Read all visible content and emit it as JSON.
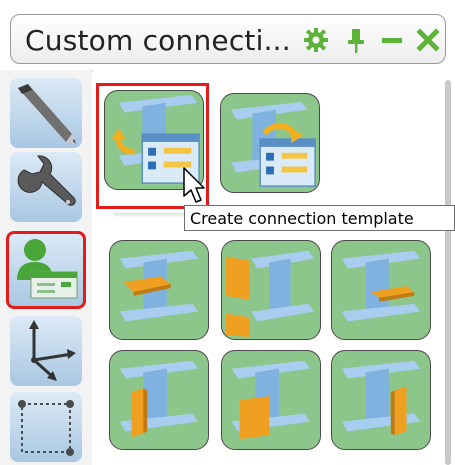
{
  "window": {
    "title": "Custom connecti..."
  },
  "titlebar_icons": [
    {
      "name": "gear-icon",
      "color": "#5cb338"
    },
    {
      "name": "pin-icon",
      "color": "#5cb338"
    },
    {
      "name": "minimize-icon",
      "color": "#5cb338"
    },
    {
      "name": "close-icon",
      "color": "#5cb338"
    }
  ],
  "sidebar": {
    "items": [
      {
        "icon": "pen-icon",
        "selected": false
      },
      {
        "icon": "wrench-icon",
        "selected": false
      },
      {
        "icon": "user-component-icon",
        "selected": true
      },
      {
        "icon": "axes-icon",
        "selected": false
      },
      {
        "icon": "dotted-rectangle-icon",
        "selected": false
      }
    ]
  },
  "grid": {
    "rows": [
      [
        {
          "icon": "create-connection-template-icon",
          "selected": true
        },
        {
          "icon": "update-connection-template-icon",
          "selected": false
        }
      ],
      [
        {
          "icon": "flange-plate-icon",
          "selected": false
        },
        {
          "icon": "end-plate-icon",
          "selected": false
        },
        {
          "icon": "cap-plate-icon",
          "selected": false
        }
      ],
      [
        {
          "icon": "web-stiffener-icon",
          "selected": false
        },
        {
          "icon": "web-plate-icon",
          "selected": false
        },
        {
          "icon": "column-stiffener-icon",
          "selected": false
        }
      ]
    ]
  },
  "tooltip": {
    "text": "Create connection template"
  },
  "colors": {
    "accent_green": "#5cb338",
    "tile_green": "#8dc68b",
    "selection_red": "#e21b1b",
    "plate_orange": "#f0a020",
    "beam_blue": "#7fb2df"
  }
}
